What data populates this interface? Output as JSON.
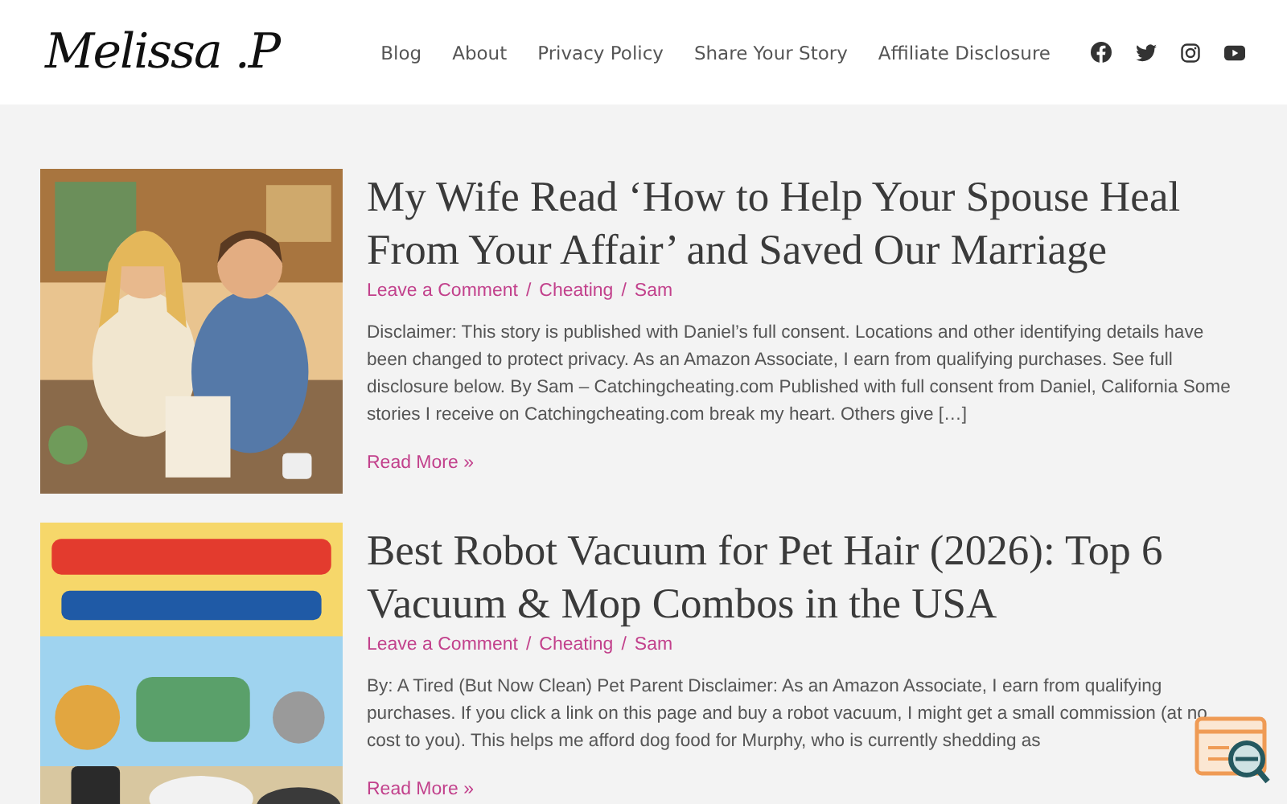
{
  "header": {
    "logo": "Melissa .P",
    "nav": [
      {
        "label": "Blog"
      },
      {
        "label": "About"
      },
      {
        "label": "Privacy Policy"
      },
      {
        "label": "Share Your Story"
      },
      {
        "label": "Affiliate Disclosure"
      }
    ]
  },
  "posts": [
    {
      "title": "My Wife Read ‘How to Help Your Spouse Heal From Your Affair’ and Saved Our Marriage",
      "meta": [
        "Leave a Comment",
        "Cheating",
        "Sam"
      ],
      "separator": "/",
      "excerpt": "Disclaimer: This story is published with Daniel’s full consent. Locations and other identifying details have been changed to protect privacy. As an Amazon Associate, I earn from qualifying purchases. See full disclosure below. By Sam – Catchingcheating.com Published with full consent from Daniel, California Some stories I receive on Catchingcheating.com break my heart. Others give […]",
      "read_more": "Read More »"
    },
    {
      "title": "Best Robot Vacuum for Pet Hair (2026): Top 6 Vacuum & Mop Combos in the USA",
      "meta": [
        "Leave a Comment",
        "Cheating",
        "Sam"
      ],
      "separator": "/",
      "excerpt": "By: A Tired (But Now Clean) Pet Parent Disclaimer: As an Amazon Associate, I earn from qualifying purchases. If you click a link on this page and buy a robot vacuum, I might get a small commission (at no cost to you). This helps me afford dog food for Murphy, who is currently shedding as",
      "read_more": "Read More »"
    }
  ]
}
